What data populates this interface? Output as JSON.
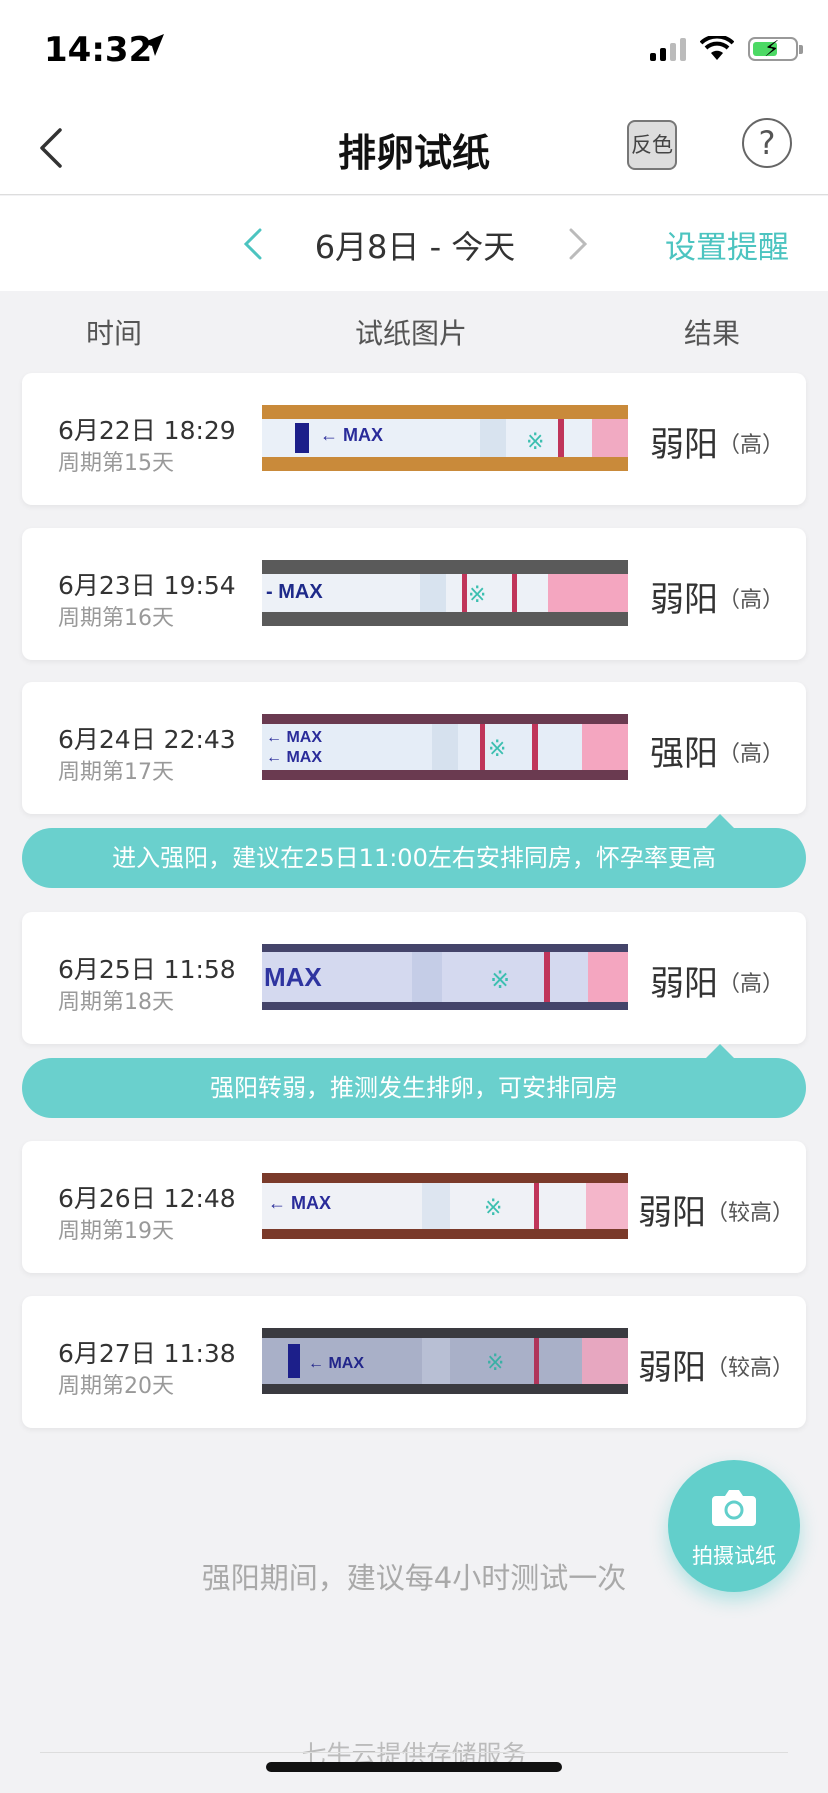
{
  "status_bar": {
    "time": "14:32"
  },
  "nav": {
    "title": "排卵试纸",
    "invert_label": "反色",
    "help_label": "?"
  },
  "date_bar": {
    "label": "6月8日 - 今天",
    "reminder": "设置提醒"
  },
  "columns": {
    "time": "时间",
    "image": "试纸图片",
    "result": "结果"
  },
  "records": [
    {
      "time": "6月22日 18:29",
      "cycle": "周期第15天",
      "result": "弱阳",
      "level": "（高）"
    },
    {
      "time": "6月23日 19:54",
      "cycle": "周期第16天",
      "result": "弱阳",
      "level": "（高）"
    },
    {
      "time": "6月24日 22:43",
      "cycle": "周期第17天",
      "result": "强阳",
      "level": "（高）"
    },
    {
      "time": "6月25日 11:58",
      "cycle": "周期第18天",
      "result": "弱阳",
      "level": "（高）"
    },
    {
      "time": "6月26日 12:48",
      "cycle": "周期第19天",
      "result": "弱阳",
      "level": "（较高）"
    },
    {
      "time": "6月27日 11:38",
      "cycle": "周期第20天",
      "result": "弱阳",
      "level": "（较高）"
    }
  ],
  "tips": [
    "进入强阳，建议在25日11:00左右安排同房，怀孕率更高",
    "强阳转弱，推测发生排卵，可安排同房"
  ],
  "footer": {
    "hint": "强阳期间，建议每4小时测试一次",
    "fab_label": "拍摄试纸",
    "storage": "七牛云提供存储服务"
  },
  "colors": {
    "accent": "#4cc4c0",
    "banner": "#6ad0cd",
    "fab": "#62cfcb"
  }
}
